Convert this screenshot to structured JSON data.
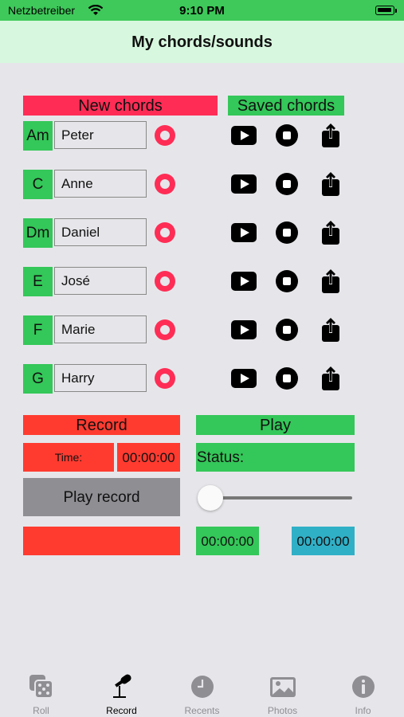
{
  "status_bar": {
    "carrier": "Netzbetreiber",
    "time": "9:10 PM"
  },
  "nav": {
    "title": "My chords/sounds"
  },
  "headers": {
    "new_chords": "New chords",
    "saved_chords": "Saved chords"
  },
  "rows": [
    {
      "chord": "Am",
      "name": "Peter"
    },
    {
      "chord": "C",
      "name": "Anne"
    },
    {
      "chord": "Dm",
      "name": "Daniel"
    },
    {
      "chord": "E",
      "name": "José"
    },
    {
      "chord": "F",
      "name": "Marie"
    },
    {
      "chord": "G",
      "name": "Harry"
    }
  ],
  "record": {
    "header": "Record",
    "time_label": "Time:",
    "time_value": "00:00:00",
    "play_record": "Play record"
  },
  "play": {
    "header": "Play",
    "status": "Status:",
    "elapsed": "00:00:00",
    "duration": "00:00:00",
    "slider_value": 0
  },
  "tabs": [
    {
      "label": "Roll",
      "icon": "dice-icon"
    },
    {
      "label": "Record",
      "icon": "microphone-icon"
    },
    {
      "label": "Recents",
      "icon": "clock-icon"
    },
    {
      "label": "Photos",
      "icon": "photo-icon"
    },
    {
      "label": "Info",
      "icon": "info-icon"
    }
  ],
  "active_tab": "Record",
  "colors": {
    "green": "#34c759",
    "pink": "#ff2d55",
    "red": "#ff3b30",
    "teal": "#30b0c7",
    "gray": "#8e8e93"
  }
}
